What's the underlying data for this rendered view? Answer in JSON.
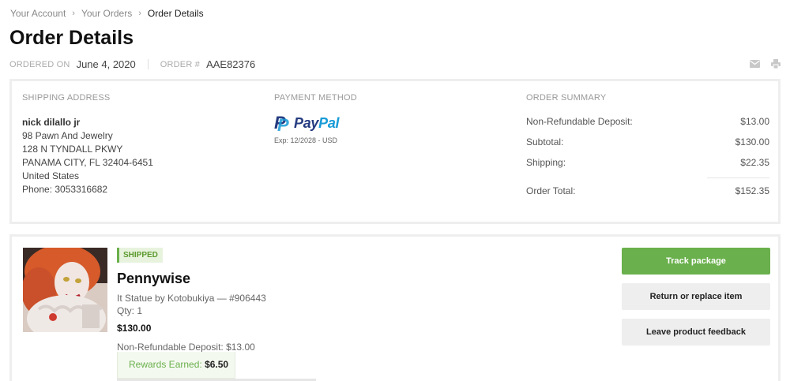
{
  "breadcrumb": {
    "items": [
      "Your Account",
      "Your Orders"
    ],
    "current": "Order Details",
    "separator": "›"
  },
  "page": {
    "title": "Order Details"
  },
  "order": {
    "ordered_on_label": "ORDERED ON",
    "ordered_on": "June 4, 2020",
    "order_num_label": "ORDER #",
    "order_num": "AAE82376"
  },
  "toolbar": {
    "icons": [
      "envelope-icon",
      "print-icon"
    ]
  },
  "shipping": {
    "label": "SHIPPING ADDRESS",
    "name": "nick dilallo jr",
    "lines": [
      "98 Pawn And Jewelry",
      "128 N TYNDALL PKWY",
      "PANAMA CITY, FL 32404-6451",
      "United States",
      "Phone: 3053316682"
    ]
  },
  "payment": {
    "label": "PAYMENT METHOD",
    "brand_pay": "Pay",
    "brand_pal": "Pal",
    "expiry": "Exp: 12/2028 - USD"
  },
  "summary": {
    "label": "ORDER SUMMARY",
    "rows": [
      {
        "label": "Non-Refundable Deposit:",
        "value": "$13.00"
      },
      {
        "label": "Subtotal:",
        "value": "$130.00"
      },
      {
        "label": "Shipping:",
        "value": "$22.35"
      }
    ],
    "total_label": "Order Total:",
    "total_value": "$152.35"
  },
  "item": {
    "status": "SHIPPED",
    "name": "Pennywise",
    "description": "It Statue by Kotobukiya — #906443",
    "qty": "Qty: 1",
    "price": "$130.00",
    "deposit": "Non-Refundable Deposit: $13.00",
    "rewards_label": "Rewards Earned:",
    "rewards_value": "$6.50"
  },
  "actions": {
    "track": "Track package",
    "return": "Return or replace item",
    "feedback": "Leave product feedback"
  },
  "colors": {
    "accent_green": "#6ab04c",
    "paypal_dark": "#253b80",
    "paypal_light": "#179bd7"
  }
}
